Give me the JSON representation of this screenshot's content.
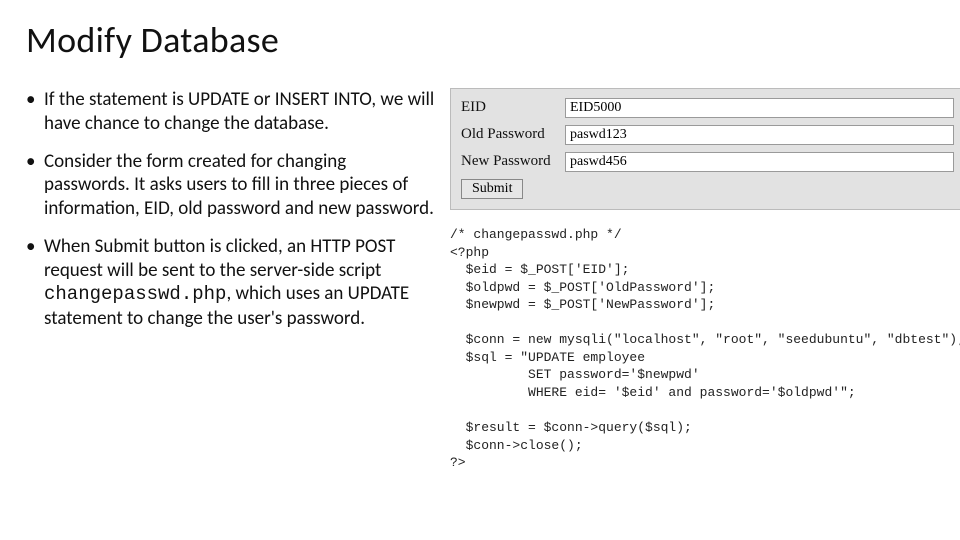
{
  "title": "Modify Database",
  "bullets": [
    {
      "text": "If the statement is UPDATE or INSERT INTO, we will have chance to change the database."
    },
    {
      "text": "Consider the form created for changing passwords. It asks users to fill in three pieces of information, EID, old password and new password."
    },
    {
      "pre": "When Submit button is clicked, an HTTP POST request will be sent to the server-side script ",
      "mono": "changepasswd.php",
      "post": ", which uses an UPDATE statement to change the user's password."
    }
  ],
  "form": {
    "rows": [
      {
        "label": "EID",
        "value": "EID5000"
      },
      {
        "label": "Old Password",
        "value": "paswd123"
      },
      {
        "label": "New Password",
        "value": "paswd456"
      }
    ],
    "submit": "Submit"
  },
  "code": {
    "l1": "/* changepasswd.php */",
    "l2": "<?php",
    "l3": "  $eid = $_POST['EID'];",
    "l4": "  $oldpwd = $_POST['OldPassword'];",
    "l5": "  $newpwd = $_POST['NewPassword'];",
    "l6": "",
    "l7": "  $conn = new mysqli(\"localhost\", \"root\", \"seedubuntu\", \"dbtest\");",
    "l8": "  $sql = \"UPDATE employee",
    "l9": "          SET password='$newpwd'",
    "l10": "          WHERE eid= '$eid' and password='$oldpwd'\";",
    "l11": "",
    "l12": "  $result = $conn->query($sql);",
    "l13": "  $conn->close();",
    "l14": "?>"
  }
}
